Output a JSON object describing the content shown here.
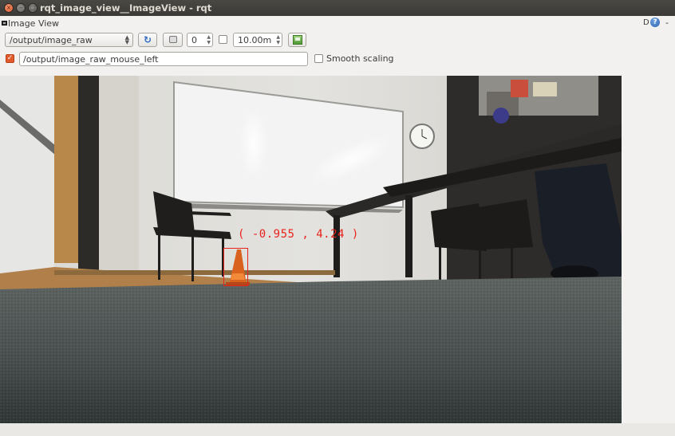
{
  "window": {
    "title": "rqt_image_view__ImageView - rqt",
    "close_glyph": "×",
    "minimize_glyph": "–",
    "maximize_glyph": "□"
  },
  "dock": {
    "title": "Image View",
    "d_label": "D",
    "help_label": "?",
    "close_label": "-"
  },
  "toolbar": {
    "topic": "/output/image_raw",
    "refresh_icon": "refresh-icon",
    "rotate_icon": "rotate-icon",
    "rotation_value": "0",
    "dynamic_range_checked": false,
    "max_range": "10.00m",
    "save_icon": "save-icon"
  },
  "mouse_publish": {
    "checked": true,
    "topic": "/output/image_raw_mouse_left",
    "smooth_scaling_label": "Smooth scaling",
    "smooth_scaling_checked": false
  },
  "image": {
    "overlay_text": "( -0.955 , 4.24 )",
    "overlay_color": "#e8231c"
  }
}
